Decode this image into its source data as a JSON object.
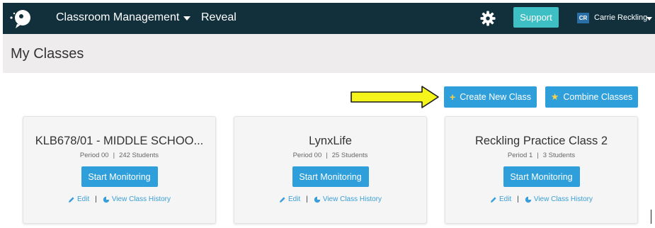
{
  "nav": {
    "menu_label": "Classroom Management",
    "reveal_label": "Reveal",
    "support_label": "Support",
    "avatar_initials": "CR",
    "user_name": "Carrie Reckling",
    "icons": [
      "logo-icon",
      "chevron-down-icon",
      "gear-icon"
    ]
  },
  "header": {
    "title": "My Classes"
  },
  "actions": {
    "create_label": "Create New Class",
    "combine_label": "Combine Classes",
    "create_icon": "plus-icon",
    "combine_icon": "star-icon"
  },
  "cards": [
    {
      "name": "KLB678/01 - MIDDLE SCHOO...",
      "period": "Period 00",
      "students": "242 Students",
      "monitor_label": "Start Monitoring",
      "edit_label": "Edit",
      "history_label": "View Class History"
    },
    {
      "name": "LynxLife",
      "period": "Period 00",
      "students": "25 Students",
      "monitor_label": "Start Monitoring",
      "edit_label": "Edit",
      "history_label": "View Class History"
    },
    {
      "name": "Reckling Practice Class 2",
      "period": "Period 1",
      "students": "3 Students",
      "monitor_label": "Start Monitoring",
      "edit_label": "Edit",
      "history_label": "View Class History"
    }
  ],
  "colors": {
    "navbar": "#11303b",
    "support": "#3dbfc3",
    "primary_button": "#2f9fdb",
    "arrow_fill": "#f5f51c",
    "header_bg": "#efeced"
  }
}
